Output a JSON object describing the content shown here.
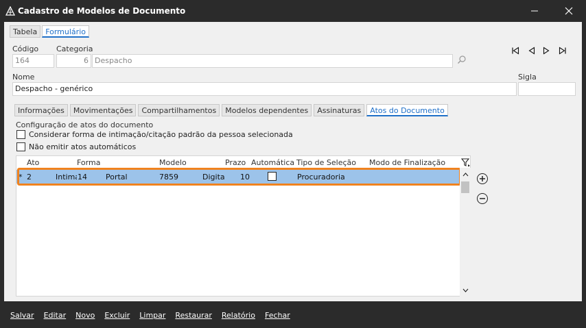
{
  "window": {
    "title": "Cadastro de Modelos de Documento"
  },
  "tabs_top": [
    {
      "label": "Tabela"
    },
    {
      "label": "Formulário"
    }
  ],
  "form": {
    "codigo_label": "Código",
    "codigo_value": "164",
    "categoria_label": "Categoria",
    "categoria_code": "6",
    "categoria_value": "Despacho",
    "nome_label": "Nome",
    "nome_value": "Despacho - genérico",
    "sigla_label": "Sigla",
    "sigla_value": ""
  },
  "tabs_inner": [
    {
      "label": "Informações"
    },
    {
      "label": "Movimentações"
    },
    {
      "label": "Compartilhamentos"
    },
    {
      "label": "Modelos dependentes"
    },
    {
      "label": "Assinaturas"
    },
    {
      "label": "Atos do Documento"
    }
  ],
  "config": {
    "section_label": "Configuração de atos do documento",
    "opt1": "Considerar forma de intimação/citação padrão da pessoa selecionada",
    "opt2": "Não emitir atos automáticos"
  },
  "grid": {
    "columns": [
      "Ato",
      "Forma",
      "Modelo",
      "Prazo",
      "Automática",
      "Tipo de Seleção",
      "Modo de Finalização"
    ],
    "row": {
      "marker": "*",
      "ato": "2",
      "ato_desc": "Intimação",
      "forma_code": "14",
      "forma": "Portal",
      "modelo_code": "7859",
      "modelo": "Digita",
      "prazo": "10",
      "tipo_selecao": "Procuradoria"
    }
  },
  "bottom_buttons": [
    {
      "label": "Salvar"
    },
    {
      "label": "Editar"
    },
    {
      "label": "Novo"
    },
    {
      "label": "Excluir"
    },
    {
      "label": "Limpar"
    },
    {
      "label": "Restaurar"
    },
    {
      "label": "Relatório"
    },
    {
      "label": "Fechar"
    }
  ],
  "colors": {
    "accent": "#1e6fc8",
    "highlight": "#f0821e",
    "row_selected": "#9cc3ea"
  },
  "icons": [
    "app-icon",
    "minimize-icon",
    "close-icon",
    "first-record-icon",
    "prev-record-icon",
    "next-record-icon",
    "last-record-icon",
    "search-icon",
    "filter-icon",
    "add-icon",
    "remove-icon"
  ]
}
